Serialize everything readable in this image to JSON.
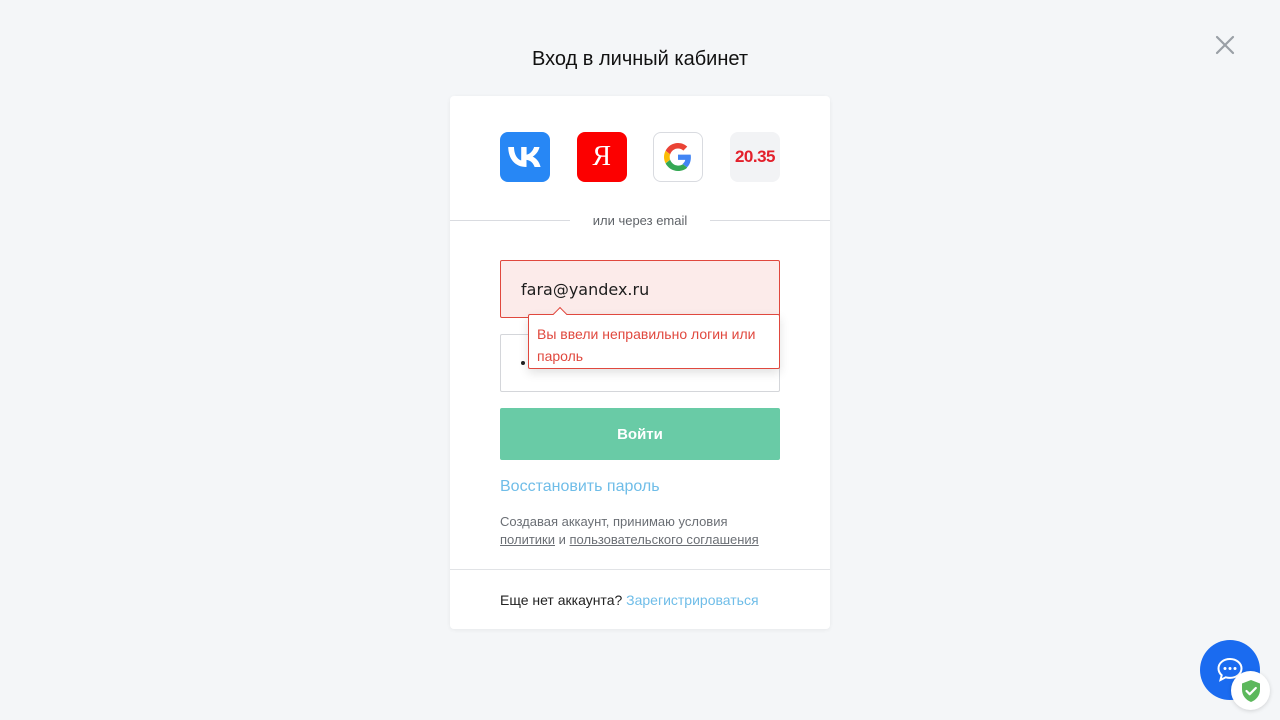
{
  "page": {
    "title": "Вход в личный кабинет"
  },
  "socials": [
    {
      "name": "vk",
      "icon": "vk-icon",
      "color": "#2787f5"
    },
    {
      "name": "yandex",
      "icon": "yandex-icon",
      "label": "Я",
      "color": "#fc0000"
    },
    {
      "name": "google",
      "icon": "google-icon"
    },
    {
      "name": "2035",
      "icon": "2035-logo",
      "label": "20.35",
      "color": "#e3202b"
    }
  ],
  "form": {
    "divider_label": "или через email",
    "email_value": "fara@yandex.ru",
    "password_masked": "•",
    "error_message": "Вы ввели неправильно логин или пароль",
    "submit_label": "Войти",
    "restore_label": "Восстановить пароль",
    "terms_prefix": "Создавая аккаунт, принимаю условия",
    "terms_policy": "политики",
    "terms_and": "и",
    "terms_agreement": "пользовательского соглашения",
    "no_account_label": "Еще нет аккаунта?",
    "register_label": "Зарегистрироваться"
  },
  "colors": {
    "accent_green": "#69cba6",
    "link_blue": "#6fbde8",
    "error_red": "#e0483e",
    "chat_blue": "#1a6bf0"
  },
  "widgets": {
    "chat_icon": "chat-icon",
    "shield_icon": "shield-check-icon"
  }
}
